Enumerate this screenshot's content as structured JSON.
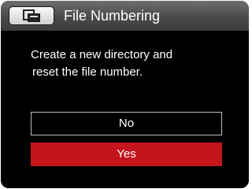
{
  "header": {
    "title": "File Numbering",
    "mode_icon": "file-folder-icon"
  },
  "message": {
    "line1": "Create a new directory and",
    "line2": "reset the file number."
  },
  "options": [
    {
      "label": "No",
      "selected": false
    },
    {
      "label": "Yes",
      "selected": true
    }
  ],
  "colors": {
    "selection": "#c4151c",
    "background": "#000000",
    "header": "#4a4a4a"
  }
}
